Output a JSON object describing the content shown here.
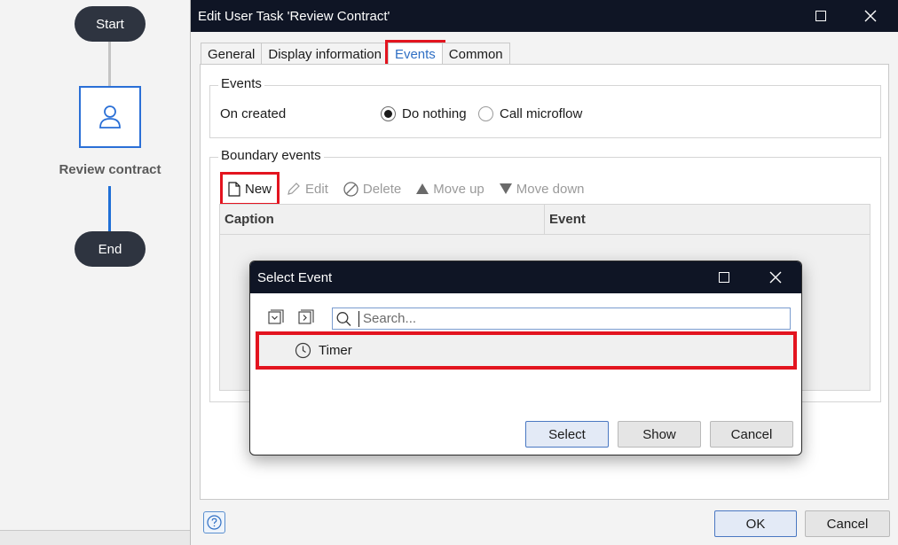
{
  "canvas": {
    "start_label": "Start",
    "task_label": "Review contract",
    "end_label": "End"
  },
  "dialog": {
    "title": "Edit User Task 'Review Contract'",
    "tabs": [
      {
        "label": "General",
        "active": false
      },
      {
        "label": "Display information",
        "active": false
      },
      {
        "label": "Events",
        "active": true
      },
      {
        "label": "Common",
        "active": false
      }
    ],
    "events_group": {
      "title": "Events",
      "on_created_label": "On created",
      "options": [
        {
          "label": "Do nothing",
          "selected": true
        },
        {
          "label": "Call microflow",
          "selected": false
        }
      ]
    },
    "boundary_group": {
      "title": "Boundary events",
      "toolbar": {
        "new": "New",
        "edit": "Edit",
        "delete": "Delete",
        "move_up": "Move up",
        "move_down": "Move down"
      },
      "columns": [
        "Caption",
        "Event"
      ]
    },
    "buttons": {
      "ok": "OK",
      "cancel": "Cancel"
    }
  },
  "modal": {
    "title": "Select Event",
    "search_placeholder": "Search...",
    "items": [
      {
        "label": "Timer",
        "icon": "clock-icon"
      }
    ],
    "buttons": {
      "select": "Select",
      "show": "Show",
      "cancel": "Cancel"
    }
  },
  "colors": {
    "titlebar": "#0f1525",
    "accent": "#2f6fc4",
    "highlight": "#e3141f",
    "node": "#2e3440"
  }
}
